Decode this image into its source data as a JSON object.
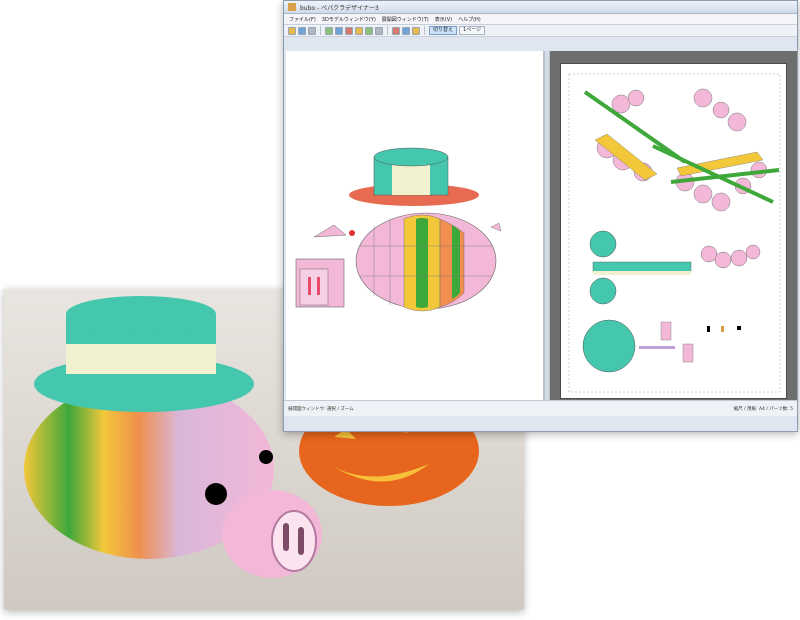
{
  "window": {
    "title": "bubo - ペパクラデザイナー3"
  },
  "menu": {
    "items": [
      "ファイル(F)",
      "3Dモデルウィンドウ(Y)",
      "展開図ウィンドウ(T)",
      "表示(V)",
      "ヘルプ(H)"
    ]
  },
  "toolbar": {
    "toggle_on_label": "切り替え",
    "toggle_off_label": "1ページ"
  },
  "status": {
    "left": "展開図ウィンドウ: 選択 / ズーム",
    "right": "縮尺 / 用紙: A4 / パーツ数: 5"
  },
  "colors": {
    "pig_pink": "#f3b7d8",
    "hat_teal": "#45c7ad",
    "hat_cream": "#f2f1cf",
    "pumpkin_orange": "#e7651c",
    "stripe_yellow": "#f3c73a",
    "stripe_green": "#3ea83a"
  }
}
